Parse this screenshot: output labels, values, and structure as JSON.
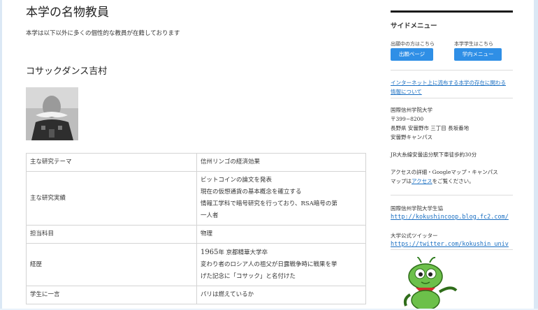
{
  "main": {
    "title": "本学の名物教員",
    "intro": "本学は以下以外に多くの個性的な教員が在籍しております",
    "professor": {
      "name": "コサックダンス吉村",
      "rows": [
        {
          "label": "主な研究テーマ",
          "lines": [
            "信州リンゴの経済効果"
          ]
        },
        {
          "label": "主な研究実績",
          "lines": [
            "ビットコインの論文を発表",
            "現在の仮想通貨の基本概念を確立する",
            "情報工学科で暗号研究を行っており、RSA暗号の第",
            "一人者"
          ]
        },
        {
          "label": "担当科目",
          "lines": [
            "物理"
          ]
        },
        {
          "label": "経歴",
          "year": "1965",
          "lines": [
            "年 京都精華大学卒",
            "変わり者のロシア人の祖父が日露戦争時に戦果を挙",
            "げた記念に「コサック」と名付けた"
          ]
        },
        {
          "label": "学生に一言",
          "lines": [
            "パリは燃えているか"
          ]
        }
      ]
    }
  },
  "sidebar": {
    "title": "サイドメニュー",
    "applicants_caption": "出願中の方はこちら",
    "applicants_button": "出願ページ",
    "students_caption": "本学学生はこちら",
    "students_button": "学内メニュー",
    "notice_link_line1": "インターネット上に流布する本学の存在に関わる",
    "notice_link_line2": "情報について",
    "address": {
      "name": "国際信州学院大学",
      "zip": "〒399−8200",
      "line1": "長野県 安曇野市 三丁目 長坂番地",
      "line2": "安曇野キャンパス"
    },
    "station": "JR大糸線安曇追分駅下車徒歩約30分",
    "access_line1": "アクセスの詳細・Googleマップ・キャンパス",
    "access_pre": "マップは",
    "access_link": "アクセス",
    "access_post": "をご覧ください。",
    "coop_label": "国際信州学院大学生協",
    "coop_url": "http://kokushincoop.blog.fc2.com/",
    "twitter_label": "大学公式ツイッター",
    "twitter_url": "https://twitter.com/kokushin_univ"
  }
}
